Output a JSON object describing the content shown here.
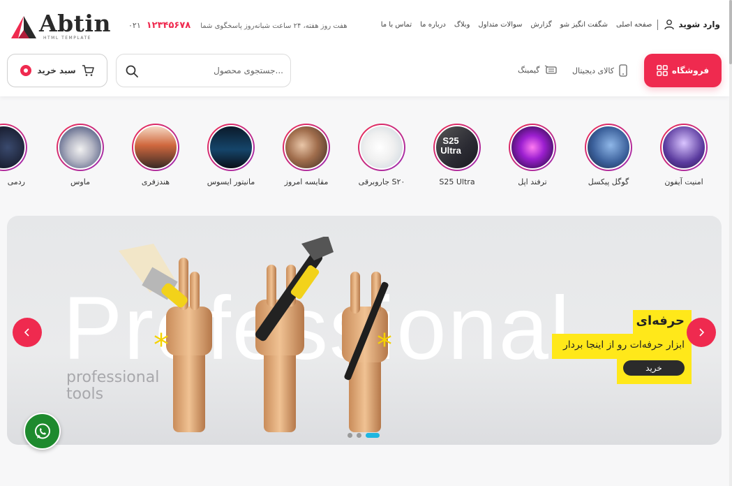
{
  "brand": {
    "name": "Abtin",
    "tagline": "HTML TEMPLATE",
    "accent": "#ef2a4f"
  },
  "contact": {
    "phone_prefix": "۰۲۱",
    "phone": "۱۲۳۴۵۶۷۸",
    "note": "هفت روز هفته، ۲۴ ساعت شبانه‌روز پاسخگوی شما"
  },
  "topnav": {
    "login": "وارد شوید",
    "links": [
      "صفحه اصلی",
      "شگفت انگیز شو",
      "گزارش",
      "سوالات متداول",
      "وبلاگ",
      "درباره ما",
      "تماس با ما"
    ]
  },
  "header": {
    "shop_label": "فروشگاه",
    "categories": [
      "کالای دیجیتال",
      "گیمینگ"
    ],
    "search_placeholder": "جستجوی محصول...",
    "cart_label": "سبد خرید"
  },
  "stories": [
    {
      "label": "امنیت آیفون"
    },
    {
      "label": "گوگل پیکسل"
    },
    {
      "label": "ترفند اپل"
    },
    {
      "label": "S25 Ultra",
      "overlay": "S25 Ultra"
    },
    {
      "label": "جاروبرقی S۲۰"
    },
    {
      "label": "مقایسه امروز"
    },
    {
      "label": "مانیتور ایسوس"
    },
    {
      "label": "هندزفری"
    },
    {
      "label": "ماوس"
    },
    {
      "label": "ردمی"
    }
  ],
  "banner": {
    "big_text": "Professional",
    "small_text": "professional tools",
    "title": "حرفه‌ای",
    "subtitle": "ابزار حرفه‌ات رو از اینجا بردار",
    "button": "خرید",
    "highlight_color": "#ffe81a",
    "slides_total": 3,
    "slide_active": 3
  },
  "icons": [
    "user-icon",
    "grid-icon",
    "phone-device-icon",
    "gamepad-icon",
    "search-icon",
    "cart-icon",
    "chevron-left-icon",
    "chevron-right-icon",
    "whatsapp-icon"
  ]
}
